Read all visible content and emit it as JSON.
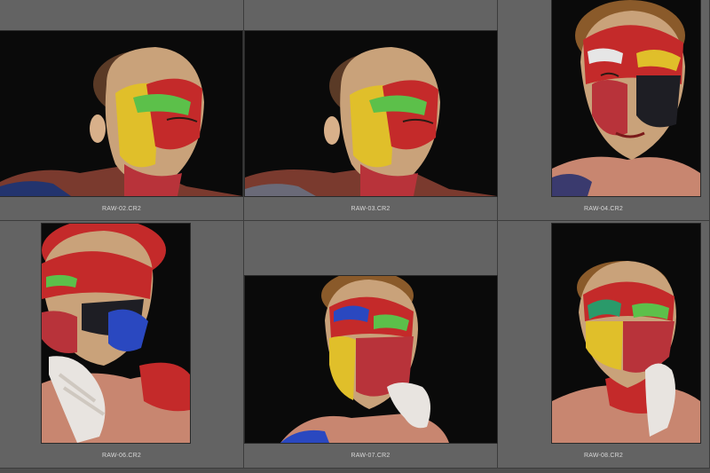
{
  "filmstrip": {
    "thumbnails": [
      {
        "filename": "RAW-02.CR2",
        "orientation": "landscape",
        "pose": "profile-left"
      },
      {
        "filename": "RAW-03.CR2",
        "orientation": "landscape",
        "pose": "profile-left"
      },
      {
        "filename": "RAW-04.CR2",
        "orientation": "portrait",
        "pose": "frontal"
      },
      {
        "filename": "RAW-06.CR2",
        "orientation": "portrait",
        "pose": "frontal-hands"
      },
      {
        "filename": "RAW-07.CR2",
        "orientation": "landscape",
        "pose": "frontal-hand"
      },
      {
        "filename": "RAW-08.CR2",
        "orientation": "portrait",
        "pose": "frontal-hand"
      }
    ]
  },
  "colors": {
    "cell_background": "#636363",
    "grid_lines": "#3c3c3c",
    "label_text": "#d8d8d8",
    "photo_background": "#090909"
  }
}
